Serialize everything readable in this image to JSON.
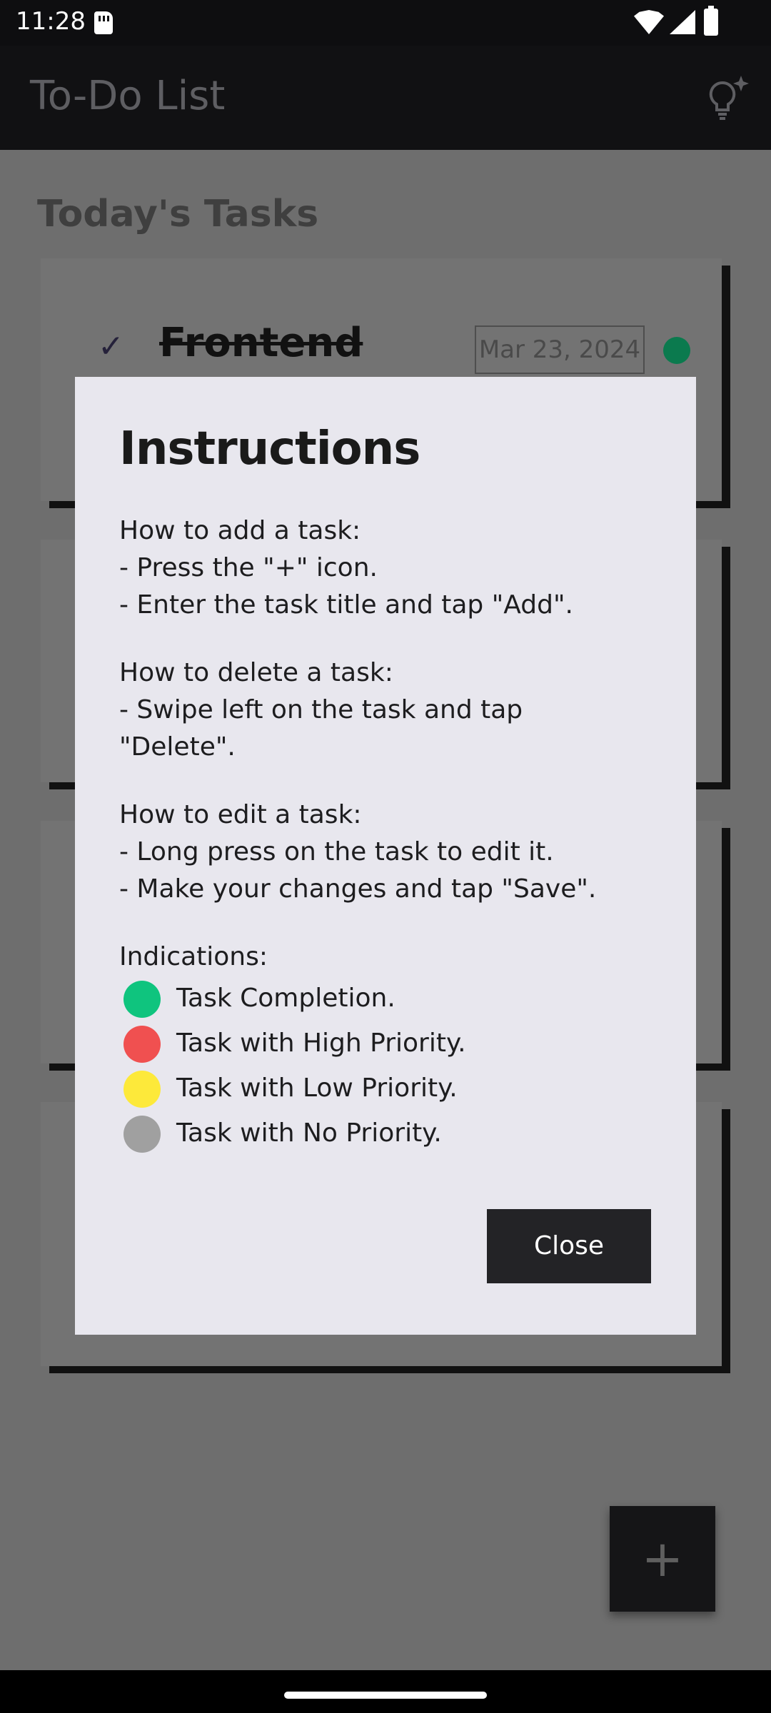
{
  "status_bar": {
    "time": "11:28"
  },
  "app_bar": {
    "title": "To-Do List"
  },
  "section": {
    "title": "Today's Tasks"
  },
  "tasks": [
    {
      "title": "Frontend",
      "date": "Mar 23, 2024",
      "status_color": "#0b7a4e",
      "completed": true
    }
  ],
  "dialog": {
    "title": "Instructions",
    "add": {
      "heading": "How to add a task:",
      "line1": "- Press the \"+\" icon.",
      "line2": "- Enter the task title and tap \"Add\"."
    },
    "delete": {
      "heading": "How to delete a task:",
      "line1": "- Swipe left on the task and tap",
      "line2": "\"Delete\"."
    },
    "edit": {
      "heading": "How to edit a task:",
      "line1": "- Long press on the task to edit it.",
      "line2": "- Make your changes and tap \"Save\"."
    },
    "indications": {
      "heading": "Indications:",
      "items": [
        {
          "label": "Task Completion.",
          "color": "#0fc47e"
        },
        {
          "label": "Task with High Priority.",
          "color": "#f05050"
        },
        {
          "label": "Task with Low Priority.",
          "color": "#fde93a"
        },
        {
          "label": "Task with No Priority.",
          "color": "#a0a0a0"
        }
      ]
    },
    "close_label": "Close"
  },
  "fab": {
    "icon": "plus-icon",
    "label": "+"
  },
  "colors": {
    "scrim": "#6e6e6e",
    "dialog_bg": "#e8e7ee",
    "button_bg": "#232326"
  }
}
